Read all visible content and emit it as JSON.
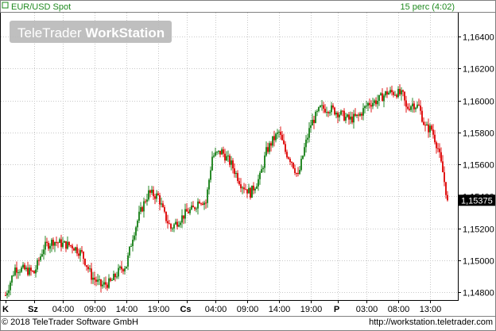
{
  "header": {
    "instrument": "EUR/USD Spot",
    "interval": "15 perc (4:02)",
    "logo_left": "TeleTrader",
    "logo_right": "WorkStation"
  },
  "footer": {
    "copyright": "© 2018 TeleTrader Software GmbH",
    "url": "http://workstation.teletrader.com"
  },
  "colors": {
    "up": "#2a8a2a",
    "down": "#e01818",
    "grid": "#c8c8c8",
    "frame": "#000000",
    "header_text": "#1f8a1f"
  },
  "chart_data": {
    "type": "candlestick",
    "title": "EUR/USD Spot",
    "interval": "15 perc (4:02)",
    "ylim": [
      1.1475,
      1.1655
    ],
    "y_ticks": [
      "1,16400",
      "1,16200",
      "1,16000",
      "1,15800",
      "1,15600",
      "1,15400",
      "1,15200",
      "1,15000",
      "1,14800"
    ],
    "y_tick_values": [
      1.164,
      1.162,
      1.16,
      1.158,
      1.156,
      1.154,
      1.152,
      1.15,
      1.148
    ],
    "x_ticks": [
      "K",
      "Sz",
      "04:00",
      "09:00",
      "14:00",
      "19:00",
      "Cs",
      "04:00",
      "09:00",
      "14:00",
      "19:00",
      "P",
      "03:00",
      "08:00",
      "13:00"
    ],
    "x_tick_index": [
      0,
      18,
      36,
      56,
      76,
      96,
      114,
      132,
      152,
      172,
      192,
      209,
      227,
      247,
      267
    ],
    "last_price": "1,15375",
    "last_value": 1.15375,
    "grid": true,
    "bars": 278,
    "anchors": [
      [
        0,
        1.1478
      ],
      [
        6,
        1.1495
      ],
      [
        12,
        1.1494
      ],
      [
        18,
        1.1492
      ],
      [
        24,
        1.1508
      ],
      [
        30,
        1.1512
      ],
      [
        36,
        1.151
      ],
      [
        42,
        1.1509
      ],
      [
        48,
        1.1504
      ],
      [
        54,
        1.149
      ],
      [
        60,
        1.1484
      ],
      [
        66,
        1.1486
      ],
      [
        72,
        1.1494
      ],
      [
        76,
        1.1497
      ],
      [
        80,
        1.1515
      ],
      [
        84,
        1.1528
      ],
      [
        88,
        1.1538
      ],
      [
        90,
        1.1542
      ],
      [
        96,
        1.154
      ],
      [
        100,
        1.1528
      ],
      [
        104,
        1.152
      ],
      [
        108,
        1.1524
      ],
      [
        114,
        1.153
      ],
      [
        118,
        1.1532
      ],
      [
        122,
        1.1538
      ],
      [
        126,
        1.1536
      ],
      [
        130,
        1.1565
      ],
      [
        136,
        1.1568
      ],
      [
        142,
        1.156
      ],
      [
        148,
        1.1548
      ],
      [
        154,
        1.1542
      ],
      [
        160,
        1.1552
      ],
      [
        164,
        1.1568
      ],
      [
        168,
        1.1575
      ],
      [
        172,
        1.158
      ],
      [
        176,
        1.1568
      ],
      [
        180,
        1.1562
      ],
      [
        184,
        1.1552
      ],
      [
        188,
        1.157
      ],
      [
        192,
        1.1585
      ],
      [
        198,
        1.1595
      ],
      [
        204,
        1.1595
      ],
      [
        210,
        1.1592
      ],
      [
        216,
        1.1588
      ],
      [
        222,
        1.159
      ],
      [
        228,
        1.1598
      ],
      [
        234,
        1.16
      ],
      [
        240,
        1.1605
      ],
      [
        246,
        1.1605
      ],
      [
        250,
        1.1603
      ],
      [
        252,
        1.1595
      ],
      [
        256,
        1.1598
      ],
      [
        260,
        1.1596
      ],
      [
        264,
        1.1583
      ],
      [
        268,
        1.1582
      ],
      [
        272,
        1.157
      ],
      [
        275,
        1.1555
      ],
      [
        278,
        1.15375
      ]
    ]
  }
}
